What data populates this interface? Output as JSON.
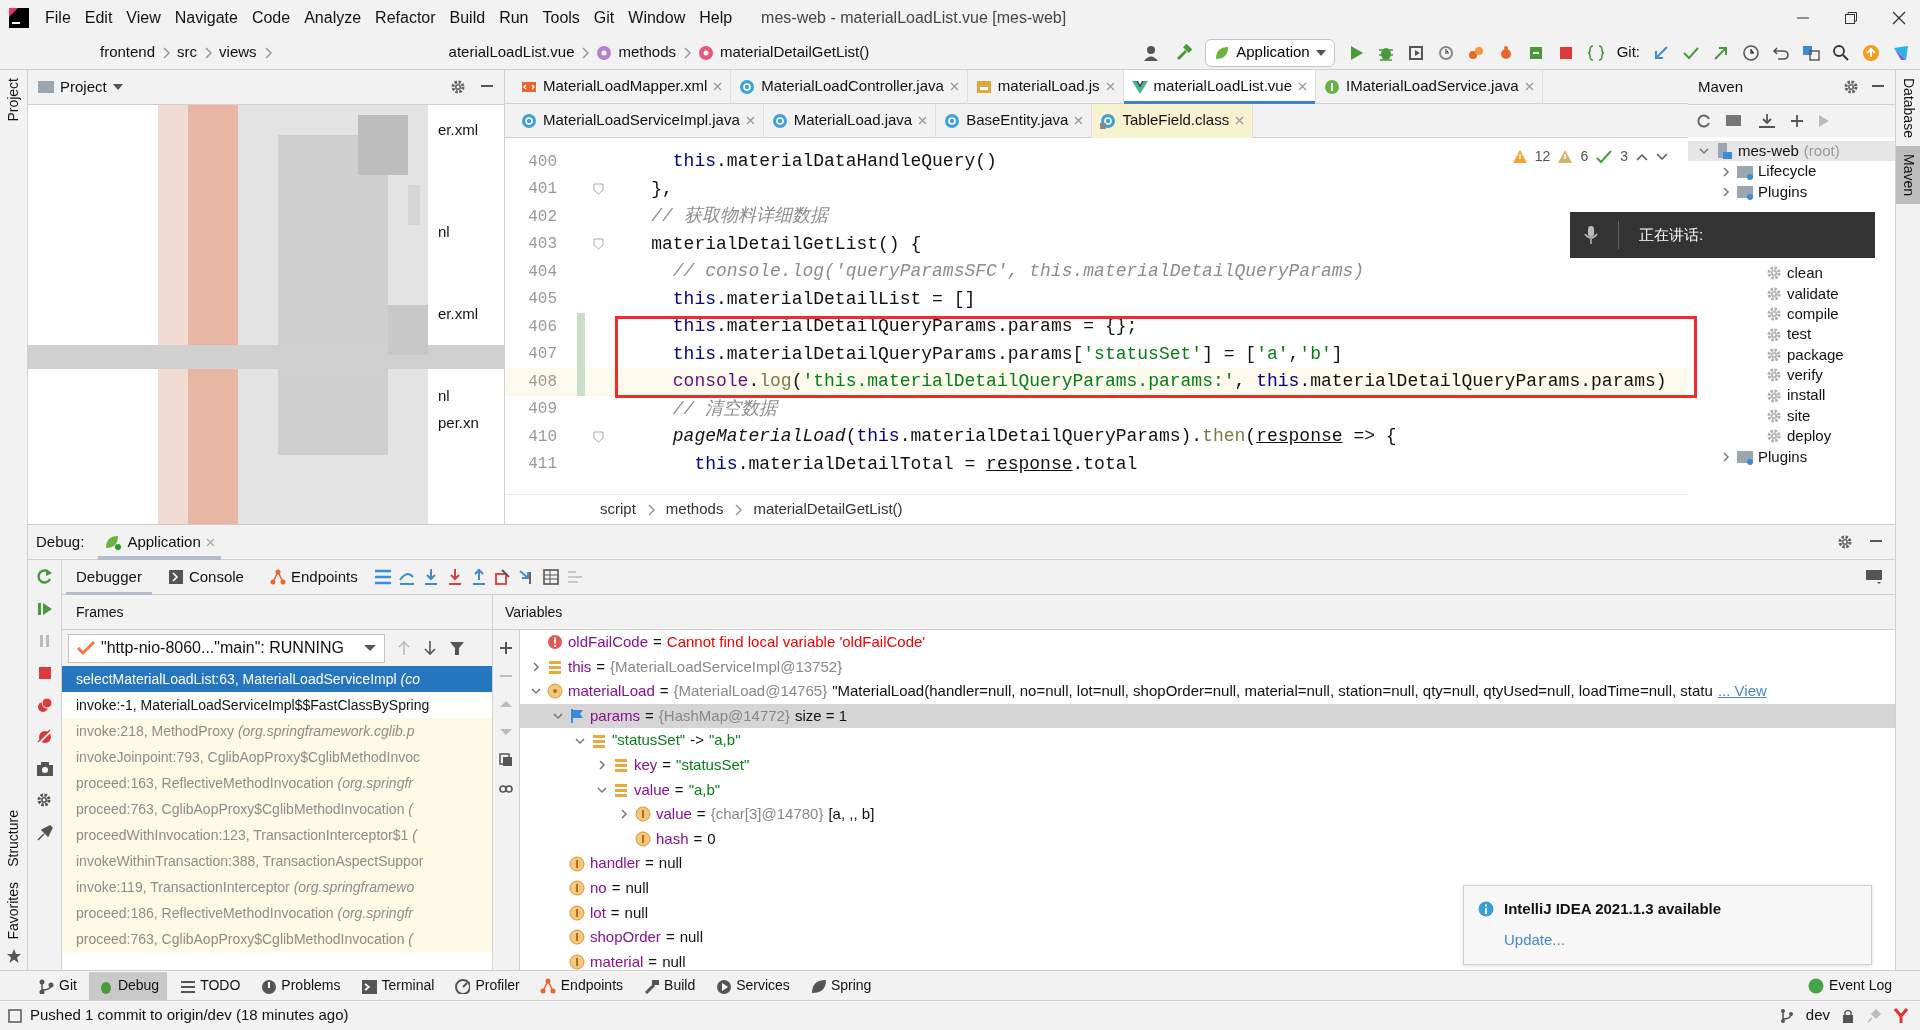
{
  "window": {
    "title": "mes-web - materialLoadList.vue [mes-web]"
  },
  "menu": [
    "File",
    "Edit",
    "View",
    "Navigate",
    "Code",
    "Analyze",
    "Refactor",
    "Build",
    "Run",
    "Tools",
    "Git",
    "Window",
    "Help"
  ],
  "navigation": {
    "path": [
      "frontend",
      "src",
      "views"
    ],
    "file": "aterialLoadList.vue",
    "symbols": [
      {
        "kind": "property",
        "label": "methods"
      },
      {
        "kind": "method",
        "label": "materialDetailGetList()"
      }
    ]
  },
  "toolbar": {
    "run_config": "Application",
    "vcs_label": "Git:"
  },
  "project": {
    "title": "Project",
    "fragments": [
      "er.xml",
      "nl",
      "er.xml",
      "nl",
      "per.xn"
    ]
  },
  "editor": {
    "tab_rows": [
      [
        {
          "label": "MaterialLoadMapper.xml",
          "kind": "xml",
          "selected": false
        },
        {
          "label": "MaterialLoadController.java",
          "kind": "class",
          "selected": false
        },
        {
          "label": "materialLoad.js",
          "kind": "js",
          "selected": false
        },
        {
          "label": "materialLoadList.vue",
          "kind": "vue",
          "selected": true
        },
        {
          "label": "IMaterialLoadService.java",
          "kind": "interface",
          "selected": false
        }
      ],
      [
        {
          "label": "MaterialLoadServiceImpl.java",
          "kind": "class",
          "selected": false
        },
        {
          "label": "MaterialLoad.java",
          "kind": "class",
          "selected": false
        },
        {
          "label": "BaseEntity.java",
          "kind": "class",
          "selected": false
        },
        {
          "label": "TableField.class",
          "kind": "classfile",
          "selected": false
        }
      ]
    ],
    "problems": {
      "warnings": "12",
      "weak_warnings": "6",
      "typos": "3"
    },
    "lines": [
      {
        "number": "400",
        "changed": false,
        "fold": false,
        "current": false,
        "tokens": [
          {
            "kind": "keyword",
            "text": "      this"
          },
          {
            "kind": "plain",
            "text": ".materialDataHandleQuery()"
          }
        ]
      },
      {
        "number": "401",
        "changed": false,
        "fold": true,
        "current": false,
        "tokens": [
          {
            "kind": "plain",
            "text": "    },"
          }
        ]
      },
      {
        "number": "402",
        "changed": false,
        "fold": false,
        "current": false,
        "tokens": [
          {
            "kind": "comment",
            "text": "    // 获取物料详细数据"
          }
        ]
      },
      {
        "number": "403",
        "changed": false,
        "fold": true,
        "current": false,
        "tokens": [
          {
            "kind": "plain",
            "text": "    materialDetailGetList() {"
          }
        ]
      },
      {
        "number": "404",
        "changed": false,
        "fold": false,
        "current": false,
        "tokens": [
          {
            "kind": "comment",
            "text": "      // console.log('queryParamsSFC', this.materialDetailQueryParams)"
          }
        ]
      },
      {
        "number": "405",
        "changed": false,
        "fold": false,
        "current": false,
        "tokens": [
          {
            "kind": "keyword",
            "text": "      this"
          },
          {
            "kind": "plain",
            "text": ".materialDetailList = []"
          }
        ]
      },
      {
        "number": "406",
        "changed": true,
        "fold": false,
        "current": false,
        "tokens": [
          {
            "kind": "keyword",
            "text": "      this"
          },
          {
            "kind": "plain",
            "text": ".materialDetailQueryParams.params = {};"
          }
        ]
      },
      {
        "number": "407",
        "changed": true,
        "fold": false,
        "current": false,
        "tokens": [
          {
            "kind": "keyword",
            "text": "      this"
          },
          {
            "kind": "plain",
            "text": ".materialDetailQueryParams.params["
          },
          {
            "kind": "string",
            "text": "'statusSet'"
          },
          {
            "kind": "plain",
            "text": "] = ["
          },
          {
            "kind": "string",
            "text": "'a'"
          },
          {
            "kind": "plain",
            "text": ","
          },
          {
            "kind": "string",
            "text": "'b'"
          },
          {
            "kind": "plain",
            "text": "]"
          }
        ]
      },
      {
        "number": "408",
        "changed": true,
        "fold": false,
        "current": true,
        "tokens": [
          {
            "kind": "global",
            "text": "      console"
          },
          {
            "kind": "plain",
            "text": "."
          },
          {
            "kind": "call",
            "text": "log"
          },
          {
            "kind": "plain",
            "text": "("
          },
          {
            "kind": "string",
            "text": "'this.materialDetailQueryParams.params:'"
          },
          {
            "kind": "plain",
            "text": ", "
          },
          {
            "kind": "keyword",
            "text": "this"
          },
          {
            "kind": "plain",
            "text": ".materialDetailQueryParams.params)"
          }
        ]
      },
      {
        "number": "409",
        "changed": false,
        "fold": false,
        "current": false,
        "tokens": [
          {
            "kind": "comment",
            "text": "      // 清空数据"
          }
        ]
      },
      {
        "number": "410",
        "changed": false,
        "fold": true,
        "current": false,
        "tokens": [
          {
            "kind": "function",
            "text": "      pageMaterialLoad"
          },
          {
            "kind": "plain",
            "text": "("
          },
          {
            "kind": "keyword",
            "text": "this"
          },
          {
            "kind": "plain",
            "text": ".materialDetailQueryParams)."
          },
          {
            "kind": "call",
            "text": "then"
          },
          {
            "kind": "plain",
            "text": "("
          },
          {
            "kind": "param",
            "text": "response"
          },
          {
            "kind": "plain",
            "text": " => {"
          }
        ]
      },
      {
        "number": "411",
        "changed": false,
        "fold": false,
        "current": false,
        "tokens": [
          {
            "kind": "keyword",
            "text": "        this"
          },
          {
            "kind": "plain",
            "text": ".materialDetailTotal = "
          },
          {
            "kind": "param",
            "text": "response"
          },
          {
            "kind": "plain",
            "text": ".total"
          }
        ]
      }
    ],
    "breadcrumb": [
      "script",
      "methods",
      "materialDetailGetList()"
    ]
  },
  "maven": {
    "title": "Maven",
    "root": {
      "label": "mes-web",
      "suffix": "(root)",
      "expanded": true,
      "children": [
        {
          "label": "Lifecycle",
          "expanded": false
        },
        {
          "label": "Plugins",
          "expanded": false
        }
      ]
    },
    "goals": [
      "clean",
      "validate",
      "compile",
      "test",
      "package",
      "verify",
      "install",
      "site",
      "deploy"
    ],
    "after": [
      {
        "label": "Plugins",
        "expanded": false
      }
    ]
  },
  "speech_overlay": {
    "text": "正在讲话:"
  },
  "debug": {
    "label": "Debug:",
    "session": "Application",
    "tabs": [
      {
        "label": "Debugger",
        "kind": "debugger",
        "selected": true
      },
      {
        "label": "Console",
        "kind": "console",
        "selected": false
      },
      {
        "label": "Endpoints",
        "kind": "endpoints",
        "selected": false
      }
    ],
    "frames_title": "Frames",
    "thread": "\"http-nio-8060...\"main\": RUNNING",
    "frames": [
      {
        "text": "selectMaterialLoadList:63, MaterialLoadServiceImpl *(co*",
        "selected": true,
        "library": false
      },
      {
        "text": "invoke:-1, MaterialLoadServiceImpl$$FastClassBySpring",
        "selected": false,
        "library": false
      },
      {
        "text": "invoke:218, MethodProxy *(org.springframework.cglib.p*",
        "selected": false,
        "library": true
      },
      {
        "text": "invokeJoinpoint:793, CglibAopProxy$CglibMethodInvoc",
        "selected": false,
        "library": true
      },
      {
        "text": "proceed:163, ReflectiveMethodInvocation *(org.springfr*",
        "selected": false,
        "library": true
      },
      {
        "text": "proceed:763, CglibAopProxy$CglibMethodInvocation *(*",
        "selected": false,
        "library": true
      },
      {
        "text": "proceedWithInvocation:123, TransactionInterceptor$1 *(*",
        "selected": false,
        "library": true
      },
      {
        "text": "invokeWithinTransaction:388, TransactionAspectSuppor",
        "selected": false,
        "library": true
      },
      {
        "text": "invoke:119, TransactionInterceptor *(org.springframewo*",
        "selected": false,
        "library": true
      },
      {
        "text": "proceed:186, ReflectiveMethodInvocation *(org.springfr*",
        "selected": false,
        "library": true
      },
      {
        "text": "proceed:763, CglibAopProxy$CglibMethodInvocation *(*",
        "selected": false,
        "library": true
      }
    ],
    "variables_title": "Variables",
    "variables": [
      {
        "kind": "error",
        "name": "oldFailCode",
        "sep": "=",
        "message": "Cannot find local variable 'oldFailCode'",
        "selected": false
      },
      {
        "kind": "object",
        "name": "this",
        "sep": "=",
        "ref": "{MaterialLoadServiceImpl@13752}",
        "expanded": false,
        "selected": false
      },
      {
        "kind": "param",
        "name": "materialLoad",
        "sep": "=",
        "ref": "{MaterialLoad@14765}",
        "value": "\"MaterialLoad(handler=null, no=null, lot=null, shopOrder=null, material=null, station=null, qty=null, qtyUsed=null, loadTime=null, statu",
        "link": "... View",
        "expanded": true,
        "selected": false,
        "children": [
          {
            "kind": "watch",
            "name": "params",
            "sep": "=",
            "ref": "{HashMap@14772}",
            "value": "size = 1",
            "expanded": true,
            "selected": true,
            "children": [
              {
                "kind": "object",
                "string_key": "\"statusSet\"",
                "sep": "->",
                "string_value": "\"a,b\"",
                "expanded": true,
                "selected": false,
                "children": [
                  {
                    "kind": "object",
                    "name": "key",
                    "sep": "=",
                    "string_value": "\"statusSet\"",
                    "expanded": false,
                    "selected": false
                  },
                  {
                    "kind": "object",
                    "name": "value",
                    "sep": "=",
                    "string_value": "\"a,b\"",
                    "expanded": true,
                    "selected": false,
                    "children": [
                      {
                        "kind": "field",
                        "name": "value",
                        "sep": "=",
                        "ref": "{char[3]@14780}",
                        "value": "[a, ,, b]",
                        "expanded": false,
                        "selected": false
                      },
                      {
                        "kind": "field",
                        "name": "hash",
                        "sep": "=",
                        "value": "0",
                        "selected": false
                      }
                    ]
                  }
                ]
              }
            ]
          },
          {
            "kind": "field",
            "name": "handler",
            "sep": "=",
            "value": "null",
            "selected": false
          },
          {
            "kind": "field",
            "name": "no",
            "sep": "=",
            "value": "null",
            "selected": false
          },
          {
            "kind": "field",
            "name": "lot",
            "sep": "=",
            "value": "null",
            "selected": false
          },
          {
            "kind": "field",
            "name": "shopOrder",
            "sep": "=",
            "value": "null",
            "selected": false
          },
          {
            "kind": "field",
            "name": "material",
            "sep": "=",
            "value": "null",
            "selected": false
          }
        ]
      }
    ]
  },
  "notification": {
    "title": "IntelliJ IDEA 2021.1.3 available",
    "link": "Update..."
  },
  "side_left": {
    "top": [
      {
        "label": "Project",
        "selected": false
      }
    ],
    "bottom": [
      {
        "label": "Structure",
        "selected": false
      },
      {
        "label": "Favorites",
        "selected": false
      }
    ]
  },
  "side_right": [
    {
      "label": "Database",
      "selected": false
    },
    {
      "label": "Maven",
      "selected": true
    }
  ],
  "tool_windows": [
    {
      "label": "Git",
      "kind": "git",
      "selected": false
    },
    {
      "label": "Debug",
      "kind": "debug",
      "selected": true
    },
    {
      "label": "TODO",
      "kind": "todo",
      "selected": false
    },
    {
      "label": "Problems",
      "kind": "problems",
      "selected": false
    },
    {
      "label": "Terminal",
      "kind": "terminal",
      "selected": false
    },
    {
      "label": "Profiler",
      "kind": "profiler",
      "selected": false
    },
    {
      "label": "Endpoints",
      "kind": "endpoints",
      "selected": false
    },
    {
      "label": "Build",
      "kind": "build",
      "selected": false
    },
    {
      "label": "Services",
      "kind": "services",
      "selected": false
    },
    {
      "label": "Spring",
      "kind": "spring",
      "selected": false
    }
  ],
  "event_log": "Event Log",
  "status_bar": {
    "message": "Pushed 1 commit to origin/dev (18 minutes ago)",
    "branch": "dev"
  }
}
